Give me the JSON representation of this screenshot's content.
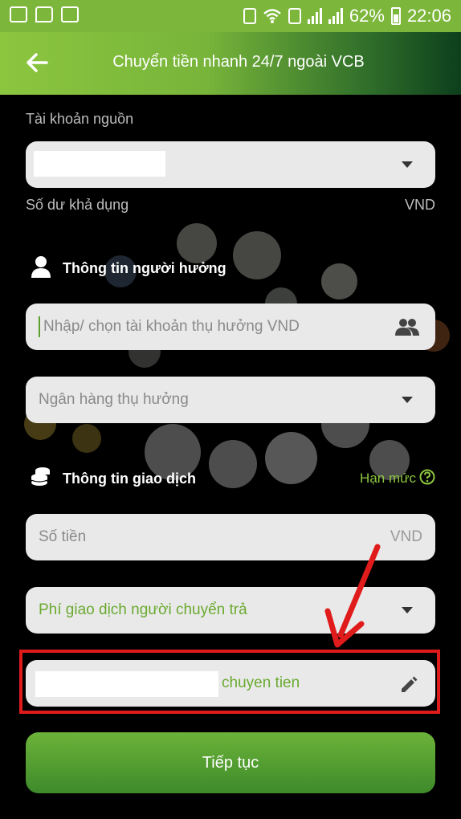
{
  "status_bar": {
    "battery": "62%",
    "time": "22:06"
  },
  "header": {
    "title": "Chuyển tiền nhanh 24/7 ngoài VCB"
  },
  "source_account": {
    "label": "Tài khoản nguồn",
    "balance_label": "Số dư khả dụng",
    "balance_currency": "VND"
  },
  "beneficiary_section": {
    "title": "Thông tin người hưởng",
    "account_placeholder": "Nhập/ chọn tài khoản thụ hưởng VND",
    "bank_placeholder": "Ngân hàng thụ hưởng"
  },
  "transaction_section": {
    "title": "Thông tin giao dịch",
    "limit_link": "Hạn mức",
    "amount_placeholder": "Số tiền",
    "amount_currency": "VND",
    "fee_option": "Phí giao dịch người chuyển trả",
    "content_suffix": "chuyen tien"
  },
  "actions": {
    "continue_label": "Tiếp tục"
  },
  "colors": {
    "brand_green": "#7cb63a",
    "accent_green": "#8cc63f",
    "highlight_red": "#e01b1b"
  }
}
